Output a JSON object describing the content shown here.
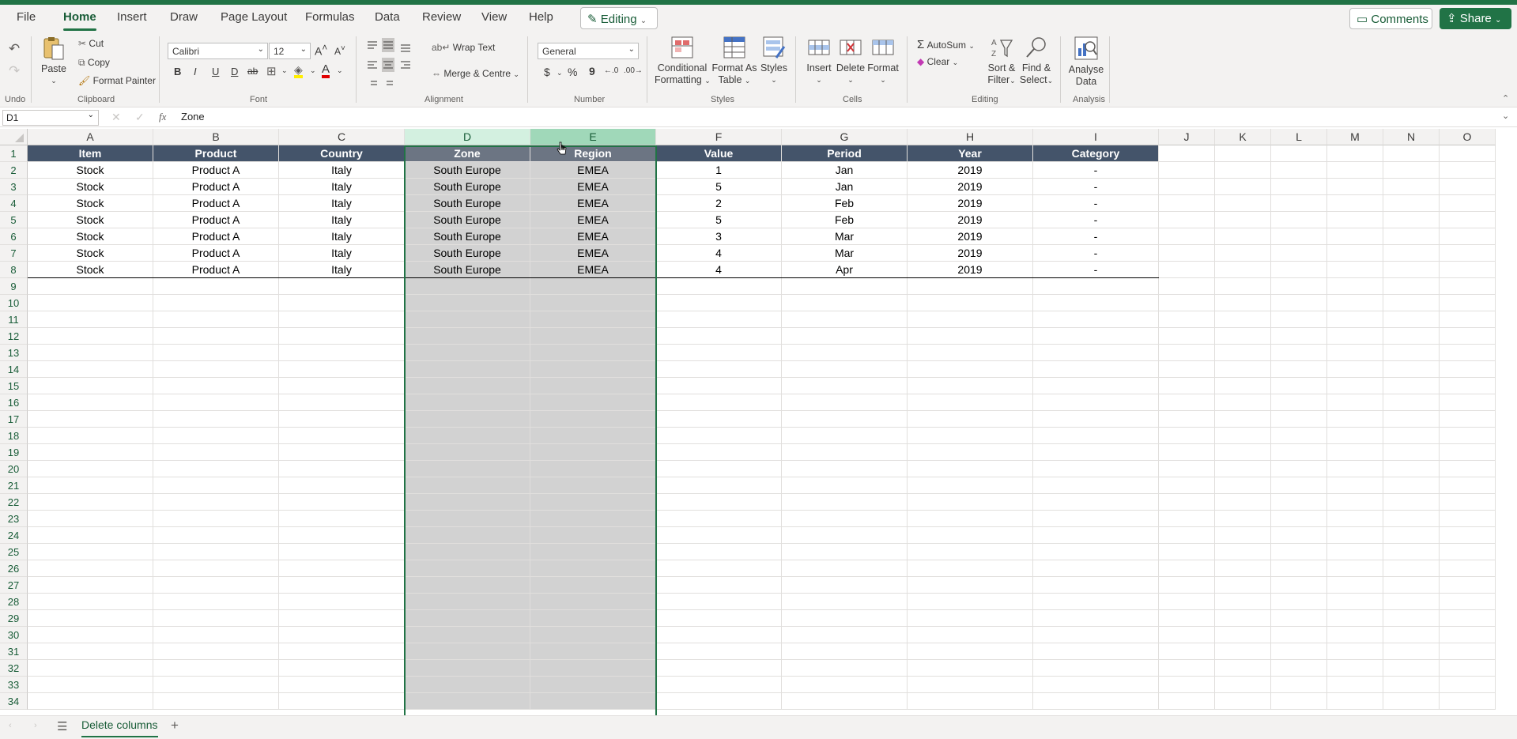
{
  "menu": [
    "File",
    "Home",
    "Insert",
    "Draw",
    "Page Layout",
    "Formulas",
    "Data",
    "Review",
    "View",
    "Help"
  ],
  "active_menu": "Home",
  "mode_label": "Editing",
  "comments_label": "Comments",
  "share_label": "Share",
  "ribbon": {
    "undo_group": "Undo",
    "paste": "Paste",
    "cut": "Cut",
    "copy": "Copy",
    "format_painter": "Format Painter",
    "clipboard_group": "Clipboard",
    "font_name": "Calibri",
    "font_size": "12",
    "font_group": "Font",
    "bold": "B",
    "italic": "I",
    "underline": "U",
    "double_underline": "D",
    "strike": "ab",
    "wrap_text": "Wrap Text",
    "merge_centre": "Merge & Centre",
    "alignment_group": "Alignment",
    "number_format": "General",
    "currency": "$",
    "percent": "%",
    "comma": "9",
    "number_group": "Number",
    "conditional_formatting_1": "Conditional",
    "conditional_formatting_2": "Formatting",
    "format_as_table_1": "Format As",
    "format_as_table_2": "Table",
    "styles_btn": "Styles",
    "styles_group": "Styles",
    "insert": "Insert",
    "delete": "Delete",
    "format": "Format",
    "cells_group": "Cells",
    "autosum": "AutoSum",
    "clear": "Clear",
    "sort_filter_1": "Sort &",
    "sort_filter_2": "Filter",
    "find_select_1": "Find &",
    "find_select_2": "Select",
    "editing_group": "Editing",
    "analyse_data_1": "Analyse",
    "analyse_data_2": "Data",
    "analysis_group": "Analysis"
  },
  "name_box": "D1",
  "fx_symbol": "fx",
  "formula": "Zone",
  "columns": [
    "A",
    "B",
    "C",
    "D",
    "E",
    "F",
    "G",
    "H",
    "I",
    "J",
    "K",
    "L",
    "M",
    "N",
    "O"
  ],
  "rows": [
    "1",
    "2",
    "3",
    "4",
    "5",
    "6",
    "7",
    "8",
    "9",
    "10",
    "11",
    "12",
    "13",
    "14",
    "15",
    "16",
    "17",
    "18",
    "19",
    "20",
    "21",
    "22",
    "23",
    "24",
    "25",
    "26",
    "27",
    "28",
    "29",
    "30",
    "31",
    "32",
    "33",
    "34"
  ],
  "headers": [
    "Item",
    "Product",
    "Country",
    "Zone",
    "Region",
    "Value",
    "Period",
    "Year",
    "Category"
  ],
  "data": [
    [
      "Stock",
      "Product A",
      "Italy",
      "South Europe",
      "EMEA",
      "1",
      "Jan",
      "2019",
      "-"
    ],
    [
      "Stock",
      "Product A",
      "Italy",
      "South Europe",
      "EMEA",
      "5",
      "Jan",
      "2019",
      "-"
    ],
    [
      "Stock",
      "Product A",
      "Italy",
      "South Europe",
      "EMEA",
      "2",
      "Feb",
      "2019",
      "-"
    ],
    [
      "Stock",
      "Product A",
      "Italy",
      "South Europe",
      "EMEA",
      "5",
      "Feb",
      "2019",
      "-"
    ],
    [
      "Stock",
      "Product A",
      "Italy",
      "South Europe",
      "EMEA",
      "3",
      "Mar",
      "2019",
      "-"
    ],
    [
      "Stock",
      "Product A",
      "Italy",
      "South Europe",
      "EMEA",
      "4",
      "Mar",
      "2019",
      "-"
    ],
    [
      "Stock",
      "Product A",
      "Italy",
      "South Europe",
      "EMEA",
      "4",
      "Apr",
      "2019",
      "-"
    ]
  ],
  "selected_columns": [
    "D",
    "E"
  ],
  "sheet_tab": "Delete columns",
  "colors": {
    "accent": "#217346",
    "header_fill": "#44546a",
    "selection": "#d2d2d2"
  }
}
